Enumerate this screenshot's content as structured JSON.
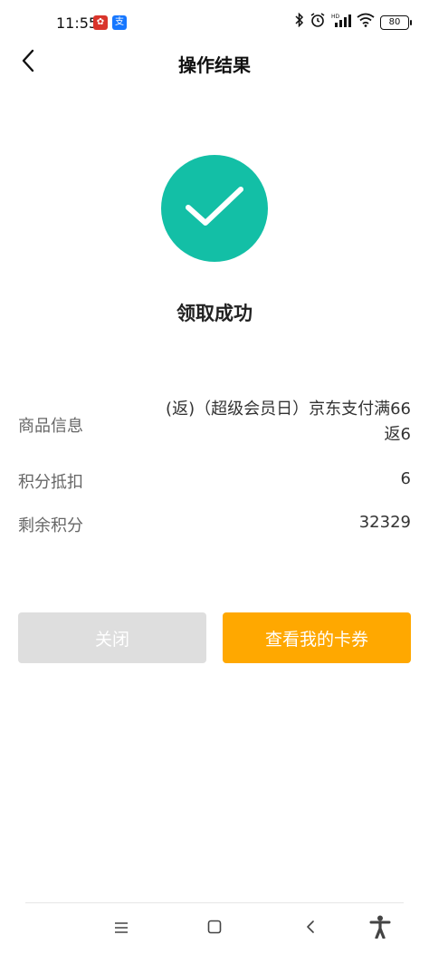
{
  "status_bar": {
    "time": "11:55",
    "battery": "80",
    "icons": [
      "bluetooth-icon",
      "alarm-icon",
      "signal-icon",
      "wifi-icon",
      "battery-icon"
    ]
  },
  "header": {
    "title": "操作结果",
    "back_icon": "chevron-left-icon"
  },
  "result": {
    "icon": "check-icon",
    "accent_color": "#13bfa6",
    "message": "领取成功"
  },
  "details": {
    "goods": {
      "label": "商品信息",
      "value_line1": "(返)（超级会员日）京东支付满66",
      "value_line2": "返6"
    },
    "points_deduct": {
      "label": "积分抵扣",
      "value": "6"
    },
    "points_remaining": {
      "label": "剩余积分",
      "value": "32329"
    }
  },
  "actions": {
    "close_label": "关闭",
    "view_coupons_label": "查看我的卡券",
    "primary_color": "#ffa800"
  },
  "nav_bar": {
    "icons": [
      "menu-icon",
      "home-icon",
      "back-icon",
      "accessibility-icon"
    ]
  }
}
